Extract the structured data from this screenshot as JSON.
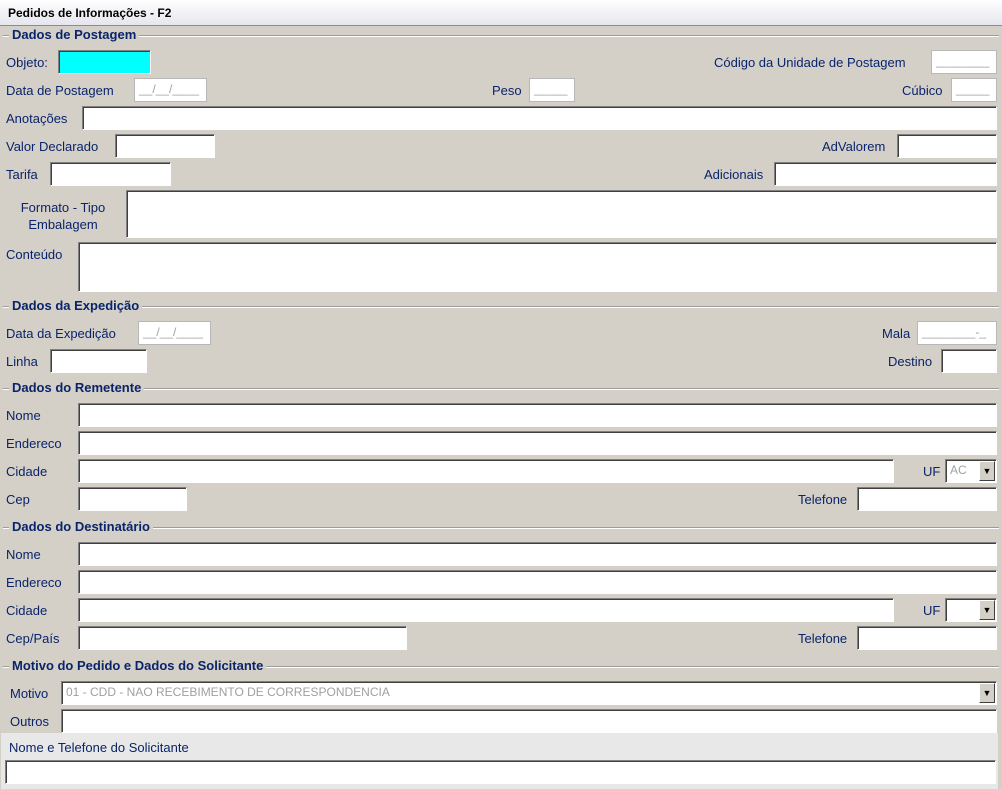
{
  "window": {
    "title": "Pedidos de Informações - F2"
  },
  "postagem": {
    "section_title": "Dados de Postagem",
    "objeto_label": "Objeto:",
    "codigo_unidade_label": "Código da Unidade de Postagem",
    "codigo_unidade_value": "________",
    "data_postagem_label": "Data de Postagem",
    "data_postagem_value": "__/__/____",
    "peso_label": "Peso",
    "peso_value": "_____",
    "cubico_label": "Cúbico",
    "cubico_value": "_____",
    "anotacoes_label": "Anotações",
    "valor_declarado_label": "Valor Declarado",
    "advalorem_label": "AdValorem",
    "tarifa_label": "Tarifa",
    "adicionais_label": "Adicionais",
    "formato_label_line1": "Formato - Tipo",
    "formato_label_line2": "Embalagem",
    "conteudo_label": "Conteúdo"
  },
  "expedicao": {
    "section_title": "Dados da Expedição",
    "data_label": "Data da Expedição",
    "data_value": "__/__/____",
    "mala_label": "Mala",
    "mala_value": "________-_",
    "linha_label": "Linha",
    "destino_label": "Destino"
  },
  "remetente": {
    "section_title": "Dados do Remetente",
    "nome_label": "Nome",
    "endereco_label": "Endereco",
    "cidade_label": "Cidade",
    "uf_label": "UF",
    "uf_value": "AC",
    "cep_label": "Cep",
    "telefone_label": "Telefone"
  },
  "destinatario": {
    "section_title": "Dados do Destinatário",
    "nome_label": "Nome",
    "endereco_label": "Endereco",
    "cidade_label": "Cidade",
    "uf_label": "UF",
    "uf_value": "",
    "cep_label": "Cep/País",
    "telefone_label": "Telefone"
  },
  "motivo": {
    "section_title": "Motivo do Pedido e Dados do Solicitante",
    "motivo_label": "Motivo",
    "motivo_value": "01 - CDD - NAO RECEBIMENTO DE CORRESPONDENCIA",
    "outros_label": "Outros",
    "solicitante_label": "Nome e Telefone do Solicitante"
  },
  "icons": {
    "dropdown": "chevron-down-icon"
  }
}
